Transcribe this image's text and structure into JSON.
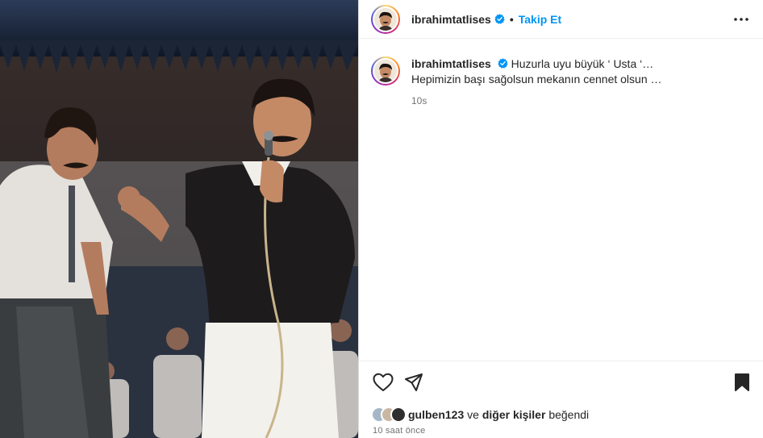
{
  "post": {
    "author": {
      "username": "ibrahimtatlises",
      "verified": true,
      "follow_label": "Takip Et",
      "separator": "•"
    },
    "caption": {
      "username": "ibrahimtatlises",
      "line1": "Huzurla uyu büyük ‘ Usta ‘…",
      "line2": "Hepimizin başı sağolsun mekanın cennet olsun …",
      "timestamp": "10s"
    },
    "likes": {
      "first_liker": "gulben123",
      "connector": "ve",
      "others": "diğer kişiler",
      "suffix": "beğendi"
    },
    "posted_ago": "10 saat önce",
    "icons": {
      "more": "more-horizontal-icon",
      "like": "heart-outline-icon",
      "share": "paper-plane-icon",
      "save": "bookmark-filled-icon",
      "verified": "verified-badge-icon"
    },
    "colors": {
      "accent": "#0095f6",
      "text": "#262626",
      "muted": "#737373"
    }
  }
}
